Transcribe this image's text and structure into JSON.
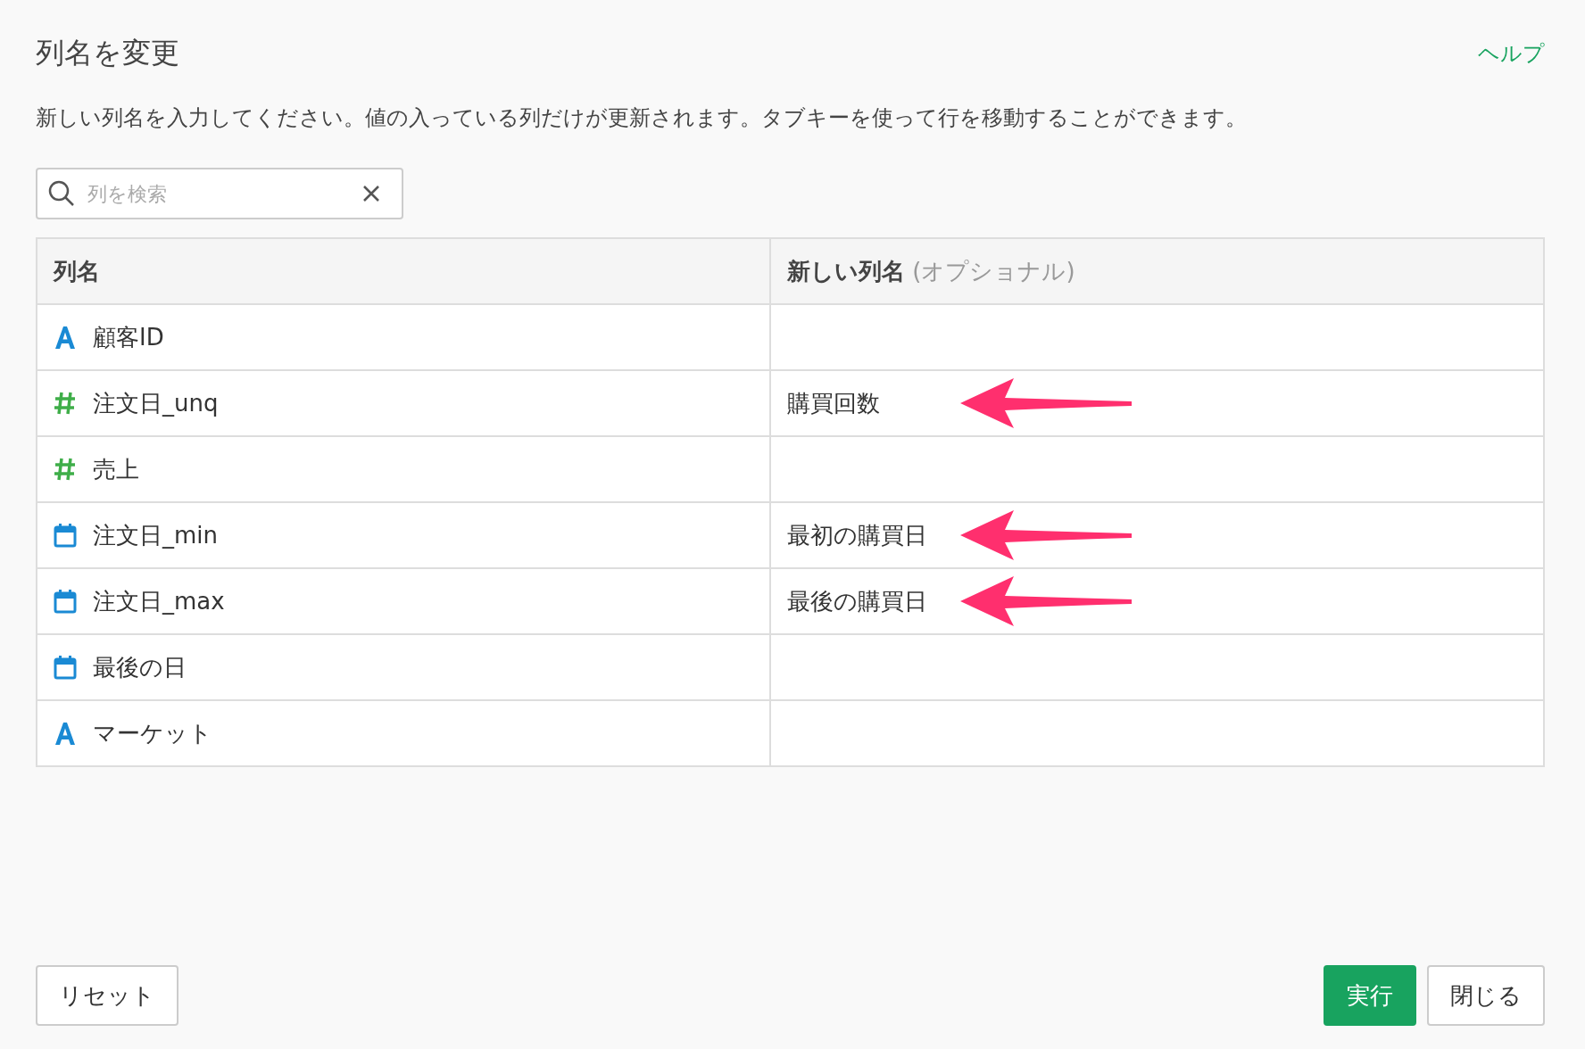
{
  "title": "列名を変更",
  "help_link": "ヘルプ",
  "description": "新しい列名を入力してください。値の入っている列だけが更新されます。タブキーを使って行を移動することができます。",
  "search": {
    "placeholder": "列を検索"
  },
  "table": {
    "columns": [
      {
        "label": "列名"
      },
      {
        "label": "新しい列名",
        "note": "(オプショナル)"
      }
    ],
    "rows": [
      {
        "kind": "text",
        "name": "顧客ID",
        "annotated": false
      },
      {
        "kind": "number",
        "name": "注文日_unq",
        "new_name": "購買回数",
        "annotated": true
      },
      {
        "kind": "number",
        "name": "売上",
        "annotated": false
      },
      {
        "kind": "date",
        "name": "注文日_min",
        "new_name": "最初の購買日",
        "annotated": true
      },
      {
        "kind": "date",
        "name": "注文日_max",
        "new_name": "最後の購買日",
        "annotated": true
      },
      {
        "kind": "date",
        "name": "最後の日",
        "annotated": false
      },
      {
        "kind": "text",
        "name": "マーケット",
        "annotated": false
      }
    ]
  },
  "buttons": {
    "reset": "リセット",
    "run": "実行",
    "close": "閉じる"
  }
}
